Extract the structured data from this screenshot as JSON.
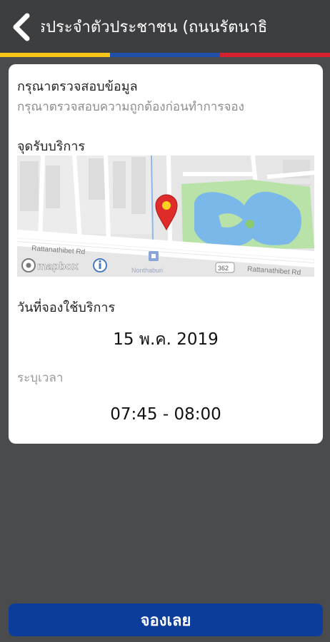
{
  "header": {
    "title": "บัตรประจำตัวประชาชน (ถนนรัตนาธิ"
  },
  "card": {
    "heading": "กรุณาตรวจสอบข้อมูล",
    "subheading": "กรุณาตรวจสอบความถูกต้องก่อนทำการจอง",
    "service_point_label": "จุดรับบริการ",
    "map": {
      "road_label": "Rattanathibet Rd",
      "road_label_right": "Rattanathibet Rd",
      "road_number": "362",
      "attribution": "mapbox",
      "place_label": "Nonthaburi"
    },
    "date_label": "วันที่จองใช้บริการ",
    "date_value": "15 พ.ค. 2019",
    "time_label": "ระบุเวลา",
    "time_value": "07:45 - 08:00"
  },
  "footer": {
    "book_button": "จองเลย"
  },
  "colors": {
    "header_bg": "#3d3e40",
    "page_bg": "#4a4b4d",
    "stripe_yellow": "#f5c518",
    "stripe_blue": "#1f4fa8",
    "stripe_red": "#d8212f",
    "button_bg": "#0d3d9b"
  }
}
